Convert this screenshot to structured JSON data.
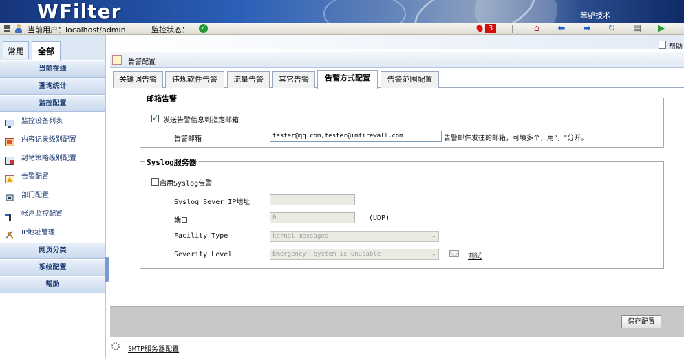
{
  "header": {
    "logo": "WFilter",
    "company": "笨驴技术"
  },
  "statusbar": {
    "current_user_label": "当前用户：localhost/admin",
    "monitor_status_label": "监控状态：",
    "status_ok_icon": "check-circle-icon",
    "alert_count": "3",
    "toolbar_icons": [
      "home-icon",
      "back-arrow-icon",
      "forward-arrow-icon",
      "refresh-icon",
      "print-icon",
      "logout-icon"
    ]
  },
  "sidebar": {
    "tabs": [
      {
        "label": "常用"
      },
      {
        "label": "全部"
      }
    ],
    "sections_top": [
      {
        "label": "当前在线"
      },
      {
        "label": "查询统计"
      },
      {
        "label": "监控配置"
      }
    ],
    "items": [
      {
        "label": "监控设备列表",
        "icon": "monitor-icon"
      },
      {
        "label": "内容记录级别配置",
        "icon": "record-icon"
      },
      {
        "label": "封堵策略级别配置",
        "icon": "block-icon"
      },
      {
        "label": "告警配置",
        "icon": "alert-config-icon"
      },
      {
        "label": "部门配置",
        "icon": "department-icon"
      },
      {
        "label": "帐户监控配置",
        "icon": "account-icon"
      },
      {
        "label": "IP地址管理",
        "icon": "ip-manage-icon"
      }
    ],
    "sections_bottom": [
      {
        "label": "网页分类"
      },
      {
        "label": "系统配置"
      },
      {
        "label": "帮助"
      }
    ]
  },
  "main": {
    "help_label": "帮助",
    "page_title": "告警配置",
    "tabs": [
      {
        "label": "关键词告警"
      },
      {
        "label": "违规软件告警"
      },
      {
        "label": "流量告警"
      },
      {
        "label": "其它告警"
      },
      {
        "label": "告警方式配置"
      },
      {
        "label": "告警范围配置"
      }
    ],
    "email": {
      "legend": "邮箱告警",
      "send_checkbox_label": "发送告警信息到指定邮箱",
      "send_checked": true,
      "address_label": "告警邮箱",
      "address_value": "tester@qq.com,tester@imfirewall.com",
      "address_hint": "告警邮件发往的邮箱，可填多个，用\"，\"分开。"
    },
    "syslog": {
      "legend": "Syslog服务器",
      "enable_label": "启用Syslog告警",
      "enable_checked": false,
      "server_ip_label": "Syslog Sever IP地址",
      "server_ip_value": "",
      "port_label": "端口",
      "port_value": "0",
      "port_unit": "(UDP)",
      "facility_label": "Facility Type",
      "facility_value": "kernel messages",
      "severity_label": "Severity Level",
      "severity_value": "Emergency: system is unusable",
      "test_label": "测试"
    },
    "save_button": "保存配置",
    "smtp_link": "SMTP服务器配置"
  }
}
